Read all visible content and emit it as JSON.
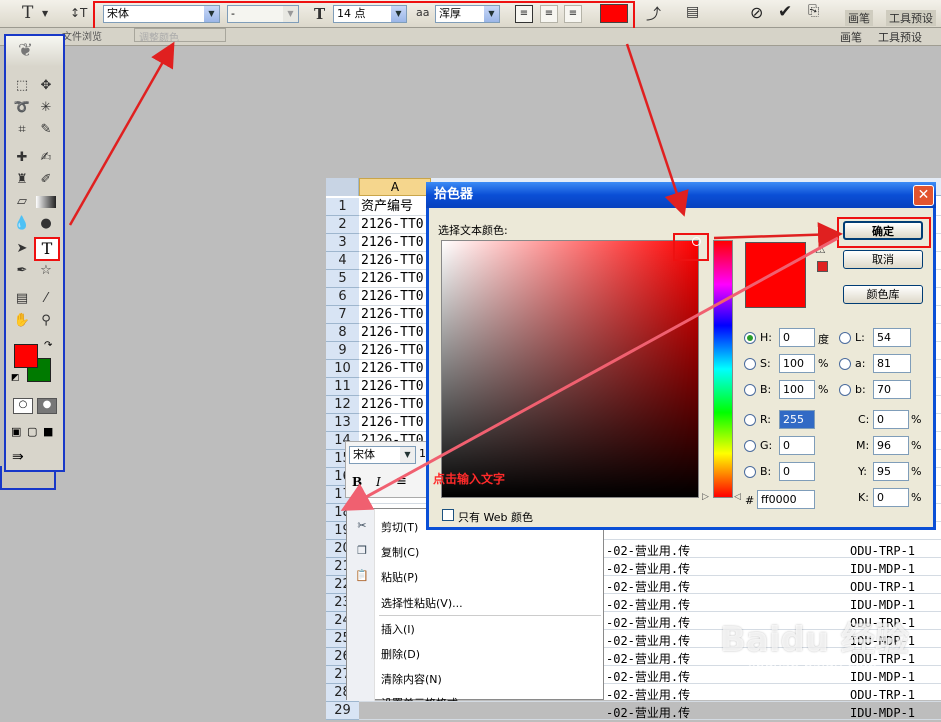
{
  "options_bar": {
    "type_tool_icon": "T",
    "orient_icon": "↕T",
    "font_family": "宋体",
    "font_style": "-",
    "size_icon": "T",
    "font_size": "14 点",
    "aa_icon": "aa",
    "antialias": "浑厚",
    "text_color": "#ff0000",
    "panel_tabs": [
      "画笔",
      "工具预设"
    ],
    "sub_label": "文件浏览",
    "sub_field": "调整颜色",
    "sub_tabs": [
      "画笔",
      "工具预设"
    ]
  },
  "toolbox": {
    "type_tool_label": "T",
    "fg_color": "#ff0000",
    "bg_color": "#007a00"
  },
  "sheet": {
    "col_header": "A",
    "rows": [
      {
        "num": "1",
        "a": "资产编号"
      },
      {
        "num": "2",
        "a": "2126-TT0"
      },
      {
        "num": "3",
        "a": "2126-TT0"
      },
      {
        "num": "4",
        "a": "2126-TT0"
      },
      {
        "num": "5",
        "a": "2126-TT0"
      },
      {
        "num": "6",
        "a": "2126-TT0"
      },
      {
        "num": "7",
        "a": "2126-TT0"
      },
      {
        "num": "8",
        "a": "2126-TT0"
      },
      {
        "num": "9",
        "a": "2126-TT0"
      },
      {
        "num": "10",
        "a": "2126-TT0"
      },
      {
        "num": "11",
        "a": "2126-TT0"
      },
      {
        "num": "12",
        "a": "2126-TT0"
      },
      {
        "num": "13",
        "a": "2126-TT0"
      },
      {
        "num": "14",
        "a": "2126-TT0"
      },
      {
        "num": "15",
        "a": ""
      },
      {
        "num": "16",
        "a": ""
      },
      {
        "num": "17",
        "a": ""
      },
      {
        "num": "18",
        "a": ""
      },
      {
        "num": "19",
        "a": ""
      },
      {
        "num": "20",
        "a": ""
      },
      {
        "num": "21",
        "a": ""
      },
      {
        "num": "22",
        "a": ""
      },
      {
        "num": "23",
        "a": ""
      },
      {
        "num": "24",
        "a": ""
      },
      {
        "num": "25",
        "a": ""
      },
      {
        "num": "26",
        "a": ""
      },
      {
        "num": "27",
        "a": ""
      },
      {
        "num": "28",
        "a": ""
      },
      {
        "num": "29",
        "a": ""
      }
    ],
    "right_rows": [
      {
        "mid": "-02-营业用.传",
        "right": "ODU-TRP-1"
      },
      {
        "mid": "-02-营业用.传",
        "right": "IDU-MDP-1"
      },
      {
        "mid": "-02-营业用.传",
        "right": "ODU-TRP-1"
      },
      {
        "mid": "-02-营业用.传",
        "right": "IDU-MDP-1"
      },
      {
        "mid": "-02-营业用.传",
        "right": "ODU-TRP-1"
      },
      {
        "mid": "-02-营业用.传",
        "right": "IDU-MDP-1"
      },
      {
        "mid": "-02-营业用.传",
        "right": "ODU-TRP-1"
      },
      {
        "mid": "-02-营业用.传",
        "right": "IDU-MDP-1"
      },
      {
        "mid": "-02-营业用.传",
        "right": "ODU-TRP-1"
      },
      {
        "mid": "-02-营业用.传",
        "right": "IDU-MDP-1"
      }
    ]
  },
  "mini_toolbar": {
    "font": "宋体",
    "size": "1",
    "bold": "B",
    "italic": "I"
  },
  "color_picker": {
    "title": "拾色器",
    "prompt": "选择文本颜色:",
    "ok": "确定",
    "cancel": "取消",
    "color_libraries": "颜色库",
    "swatch": "#ff0000",
    "fields": {
      "H": {
        "label": "H:",
        "value": "0",
        "unit": "度"
      },
      "S": {
        "label": "S:",
        "value": "100",
        "unit": "%"
      },
      "B": {
        "label": "B:",
        "value": "100",
        "unit": "%"
      },
      "R": {
        "label": "R:",
        "value": "255"
      },
      "G": {
        "label": "G:",
        "value": "0"
      },
      "Bl": {
        "label": "B:",
        "value": "0"
      },
      "L": {
        "label": "L:",
        "value": "54"
      },
      "a": {
        "label": "a:",
        "value": "81"
      },
      "b": {
        "label": "b:",
        "value": "70"
      },
      "C": {
        "label": "C:",
        "value": "0",
        "unit": "%"
      },
      "M": {
        "label": "M:",
        "value": "96",
        "unit": "%"
      },
      "Y": {
        "label": "Y:",
        "value": "95",
        "unit": "%"
      },
      "K": {
        "label": "K:",
        "value": "0",
        "unit": "%"
      }
    },
    "hex_label": "#",
    "hex": "ff0000",
    "web_only": "只有 Web 颜色",
    "annotation": "点击输入文字"
  },
  "context_menu": {
    "items": [
      {
        "label": "剪切(T)",
        "icon": "scissors-icon"
      },
      {
        "label": "复制(C)",
        "icon": "copy-icon"
      },
      {
        "label": "粘贴(P)",
        "icon": "paste-icon"
      },
      {
        "label": "选择性粘贴(V)...",
        "icon": ""
      },
      {
        "label": "插入(I)",
        "icon": ""
      },
      {
        "label": "删除(D)",
        "icon": ""
      },
      {
        "label": "清除内容(N)",
        "icon": ""
      },
      {
        "label": "设置单元格格式",
        "icon": ""
      }
    ]
  },
  "watermark": {
    "brand": "Baidu 经验",
    "url": "jingyan.baidu.com"
  }
}
